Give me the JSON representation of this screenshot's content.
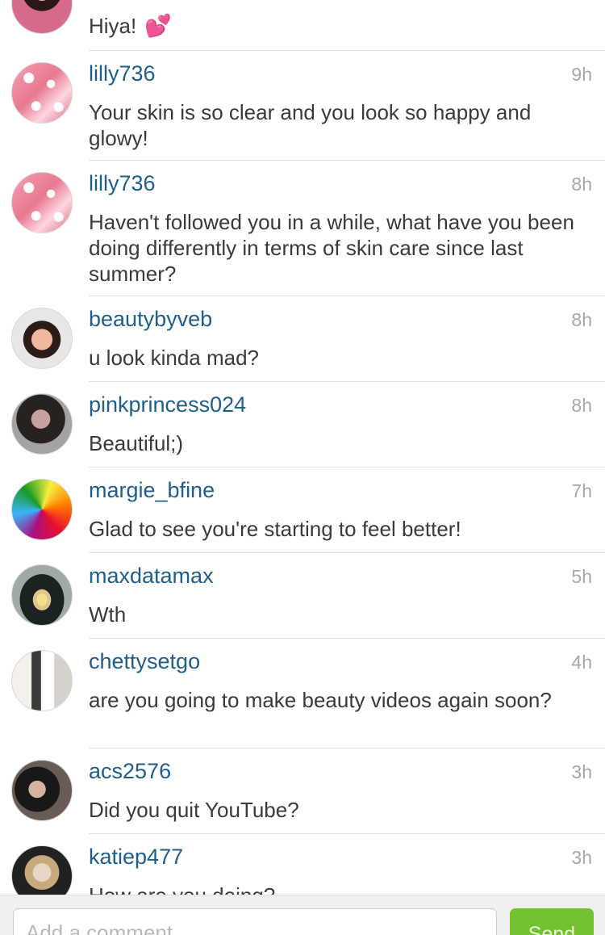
{
  "comments": [
    {
      "username": "",
      "time": "",
      "text": "Hiya!",
      "emoji": "💕"
    },
    {
      "username": "lilly736",
      "time": "9h",
      "text": "Your skin is so clear and you look so happy and glowy!"
    },
    {
      "username": "lilly736",
      "time": "8h",
      "text": "Haven't followed you in a while, what have you been doing differently in terms of skin care since last summer?"
    },
    {
      "username": "beautybyveb",
      "time": "8h",
      "text": "u look kinda mad?"
    },
    {
      "username": "pinkprincess024",
      "time": "8h",
      "text": "Beautiful;)"
    },
    {
      "username": "margie_bfine",
      "time": "7h",
      "text": "Glad to see you're starting to feel better!"
    },
    {
      "username": "maxdatamax",
      "time": "5h",
      "text": "Wth"
    },
    {
      "username": "chettysetgo",
      "time": "4h",
      "text": "are you going to make beauty videos again soon?"
    },
    {
      "username": "acs2576",
      "time": "3h",
      "text": "Did you quit YouTube?"
    },
    {
      "username": "katiep477",
      "time": "3h",
      "text": "How are you doing?"
    }
  ],
  "composer": {
    "placeholder": "Add a comment...",
    "send_label": "Send"
  },
  "colors": {
    "username": "#1f5d8b",
    "timestamp": "#a7a7a7",
    "send_button": "#74c12f"
  }
}
